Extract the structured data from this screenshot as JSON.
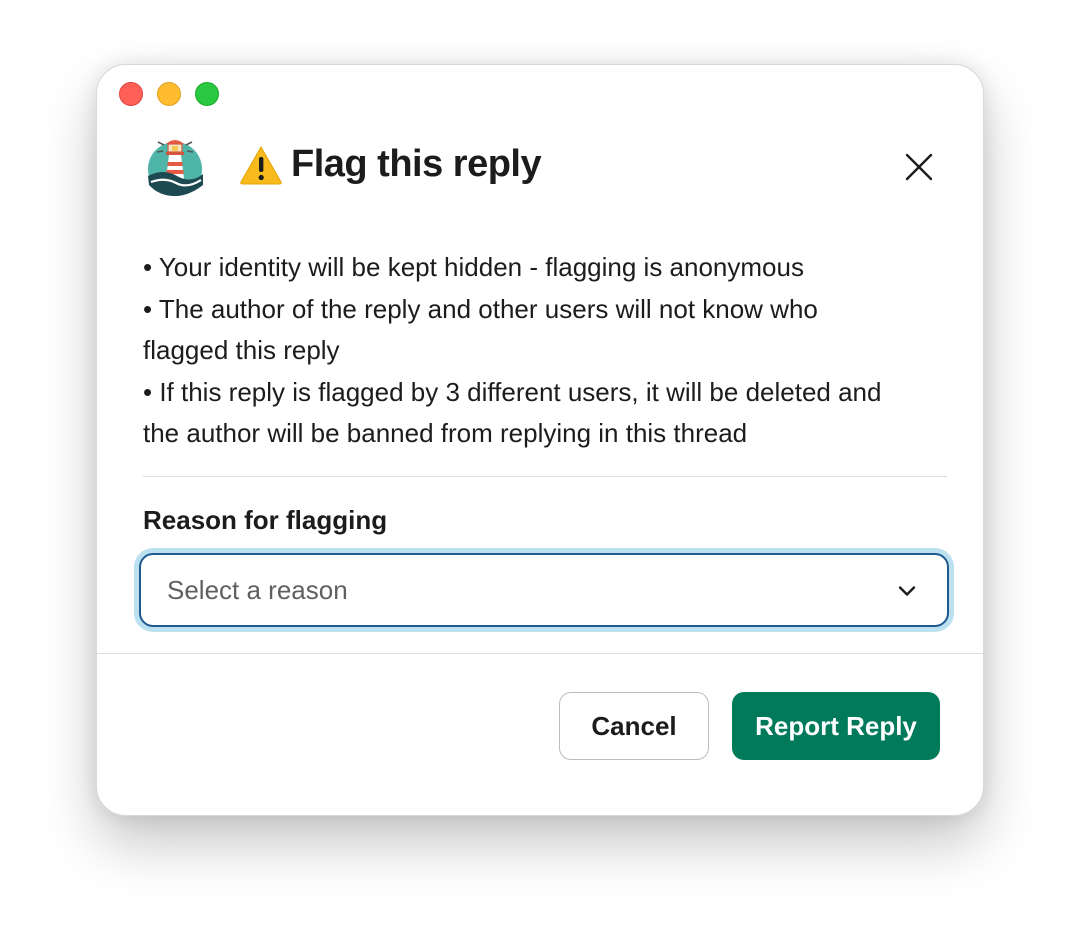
{
  "window": {
    "controls": [
      "close",
      "minimize",
      "zoom"
    ]
  },
  "header": {
    "app_logo_icon": "lighthouse-logo-icon",
    "warning_icon": "warning-icon",
    "title": "Flag this reply",
    "close_icon": "close-icon"
  },
  "info": {
    "bullets": [
      "• Your identity will be kept hidden - flagging is anonymous",
      "• The author of the reply and other users will not know who",
      "flagged this reply",
      "• If this reply is flagged by 3 different users, it will be deleted and",
      "the author will be banned from replying in this thread"
    ]
  },
  "form": {
    "label": "Reason for flagging",
    "select": {
      "placeholder": "Select a reason",
      "chevron_icon": "chevron-down-icon"
    }
  },
  "footer": {
    "cancel_label": "Cancel",
    "submit_label": "Report Reply"
  },
  "colors": {
    "primary_button": "#007a5a",
    "focus_ring": "#1d9bd1",
    "text": "#1d1c1d"
  }
}
